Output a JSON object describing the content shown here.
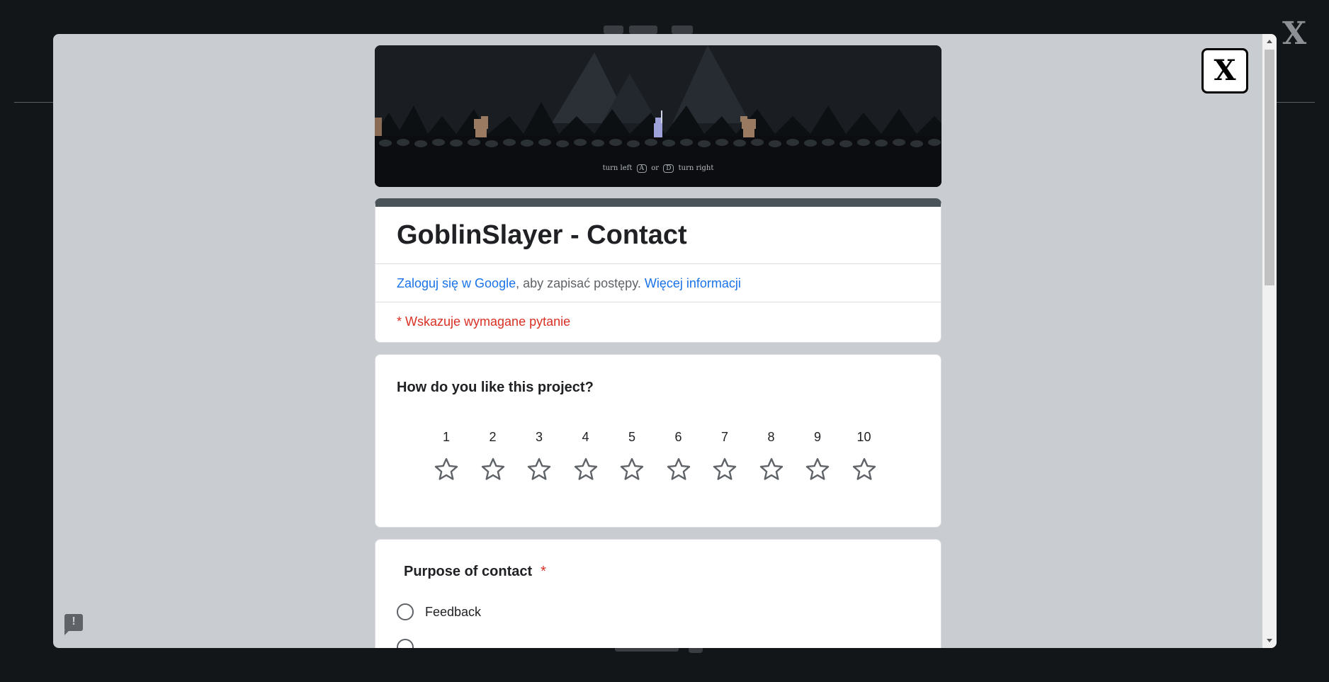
{
  "background": {
    "close_label": "X"
  },
  "modal": {
    "close_label": "X"
  },
  "banner": {
    "hint_left": "turn left",
    "key_a": "A",
    "hint_or": "or",
    "key_d": "D",
    "hint_right": "turn right"
  },
  "form": {
    "title": "GoblinSlayer - Contact",
    "signin_link": "Zaloguj się w Google",
    "signin_text": ", aby zapisać postępy. ",
    "more_info_link": "Więcej informacji",
    "required_note": "* Wskazuje wymagane pytanie"
  },
  "rating_question": {
    "title": "How do you like this project?",
    "scale": [
      "1",
      "2",
      "3",
      "4",
      "5",
      "6",
      "7",
      "8",
      "9",
      "10"
    ]
  },
  "purpose_question": {
    "title": "Purpose of contact",
    "required_mark": "*",
    "options": [
      "Feedback"
    ]
  },
  "colors": {
    "accent": "#4a5358",
    "link": "#1a73e8",
    "required": "#d93025"
  }
}
